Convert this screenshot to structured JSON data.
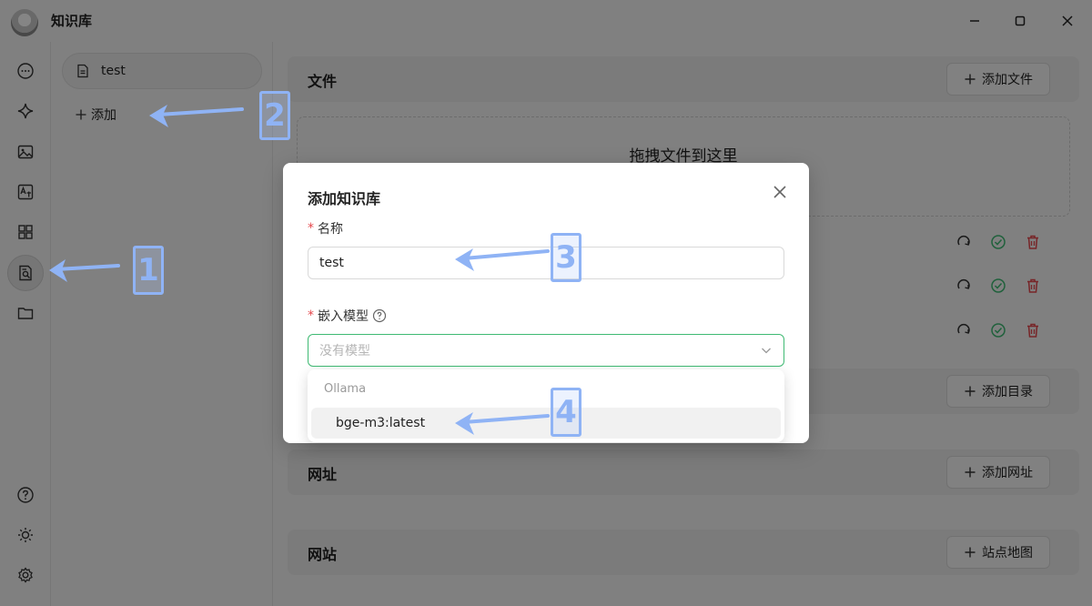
{
  "window": {
    "title": "知识库",
    "min_icon": "minimize-icon",
    "max_icon": "maximize-icon",
    "close_icon": "close-icon"
  },
  "iconbar": {
    "top_items": [
      "chat-icon",
      "sparkle-icon",
      "image-icon",
      "translate-icon",
      "apps-icon",
      "knowledge-base-icon",
      "folder-icon"
    ],
    "bottom_items": [
      "help-icon",
      "theme-icon",
      "settings-icon"
    ],
    "active": "knowledge-base-icon"
  },
  "kb_panel": {
    "items": [
      {
        "label": "test"
      }
    ],
    "add_label": "添加"
  },
  "main": {
    "files": {
      "title": "文件",
      "button": "添加文件",
      "dropzone_text": "拖拽文件到这里"
    },
    "dirs": {
      "button": "添加目录"
    },
    "urls": {
      "title": "网址",
      "button": "添加网址"
    },
    "sites": {
      "title": "网站",
      "button": "站点地图"
    }
  },
  "modal": {
    "title": "添加知识库",
    "name_label": "名称",
    "name_value": "test",
    "model_label": "嵌入模型",
    "model_placeholder": "没有模型",
    "dropdown": {
      "group": "Ollama",
      "options": [
        "bge-m3:latest"
      ]
    }
  },
  "annotations": {
    "step1": "1",
    "step2": "2",
    "step3": "3",
    "step4": "4",
    "accent_color": "#8fb3f5"
  },
  "colors": {
    "focus_border": "#3fba73",
    "required": "#e5484d",
    "success": "#3fba73",
    "danger": "#e5484d"
  }
}
